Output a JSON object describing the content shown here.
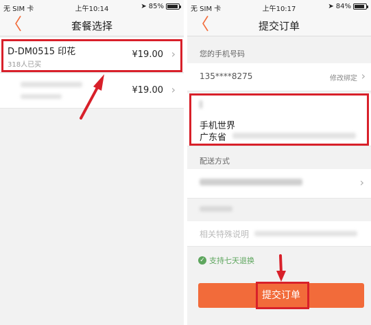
{
  "left": {
    "status": {
      "carrier": "无 SIM 卡",
      "time": "上午10:14",
      "battery": "85%",
      "battery_level": 0.85
    },
    "nav": {
      "back": "〈",
      "title": "套餐选择"
    },
    "packages": [
      {
        "name": "D-DM0515 印花",
        "sold": "318人已买",
        "price": "¥19.00",
        "chevron": "›"
      },
      {
        "name": "",
        "sold": "",
        "price": "¥19.00",
        "chevron": "›"
      }
    ]
  },
  "right": {
    "status": {
      "carrier": "无 SIM 卡",
      "time": "上午10:17",
      "battery": "84%",
      "battery_level": 0.84
    },
    "nav": {
      "back": "〈",
      "title": "提交订单"
    },
    "phone_section_label": "您的手机号码",
    "phone_number": "135****8275",
    "modify_binding": "修改绑定",
    "address": {
      "recipient": "手机世界",
      "province": "广东省"
    },
    "delivery_label": "配送方式",
    "note_placeholder": "相关特殊说明",
    "guarantee": "支持七天退换",
    "submit_label": "提交订单"
  },
  "colors": {
    "accent": "#f26b3a",
    "highlight": "#d8202a",
    "success": "#5ea65e"
  }
}
